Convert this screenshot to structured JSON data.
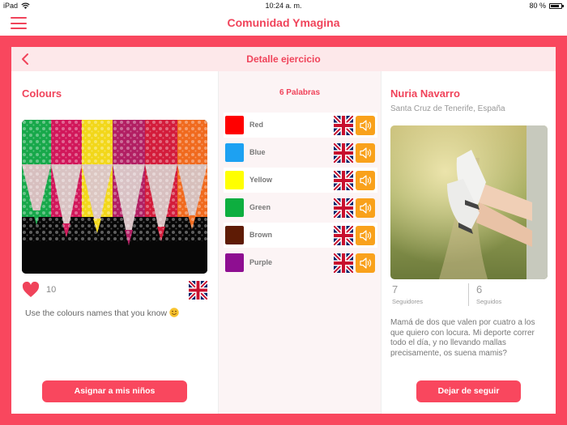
{
  "status_bar": {
    "device": "iPad",
    "time": "10:24 a. m.",
    "battery": "80 %",
    "battery_level": 0.8
  },
  "app": {
    "title": "Comunidad Ymagina",
    "accent": "#f9475e",
    "secondary": "#f9a11b"
  },
  "detail": {
    "title": "Detalle ejercicio"
  },
  "exercise": {
    "title": "Colours",
    "likes": "10",
    "description": "Use the colours names that you know",
    "assign_label": "Asignar a mis niños"
  },
  "words": {
    "count_label": "6 Palabras",
    "items": [
      {
        "label": "Red",
        "color": "#ff0000"
      },
      {
        "label": "Blue",
        "color": "#1da1f2"
      },
      {
        "label": "Yellow",
        "color": "#ffff00"
      },
      {
        "label": "Green",
        "color": "#0dae3f"
      },
      {
        "label": "Brown",
        "color": "#5e1b05"
      },
      {
        "label": "Purple",
        "color": "#8e0e91"
      }
    ]
  },
  "profile": {
    "name": "Nuria Navarro",
    "location": "Santa Cruz de Tenerife, España",
    "followers": "7",
    "followers_label": "Seguidores",
    "following": "6",
    "following_label": "Seguidos",
    "bio": "Mamá de dos que valen por cuatro a los que quiero con locura. Mi deporte correr todo el día, y no llevando mallas precisamente, os suena mamis?",
    "unfollow_label": "Dejar de seguir"
  }
}
